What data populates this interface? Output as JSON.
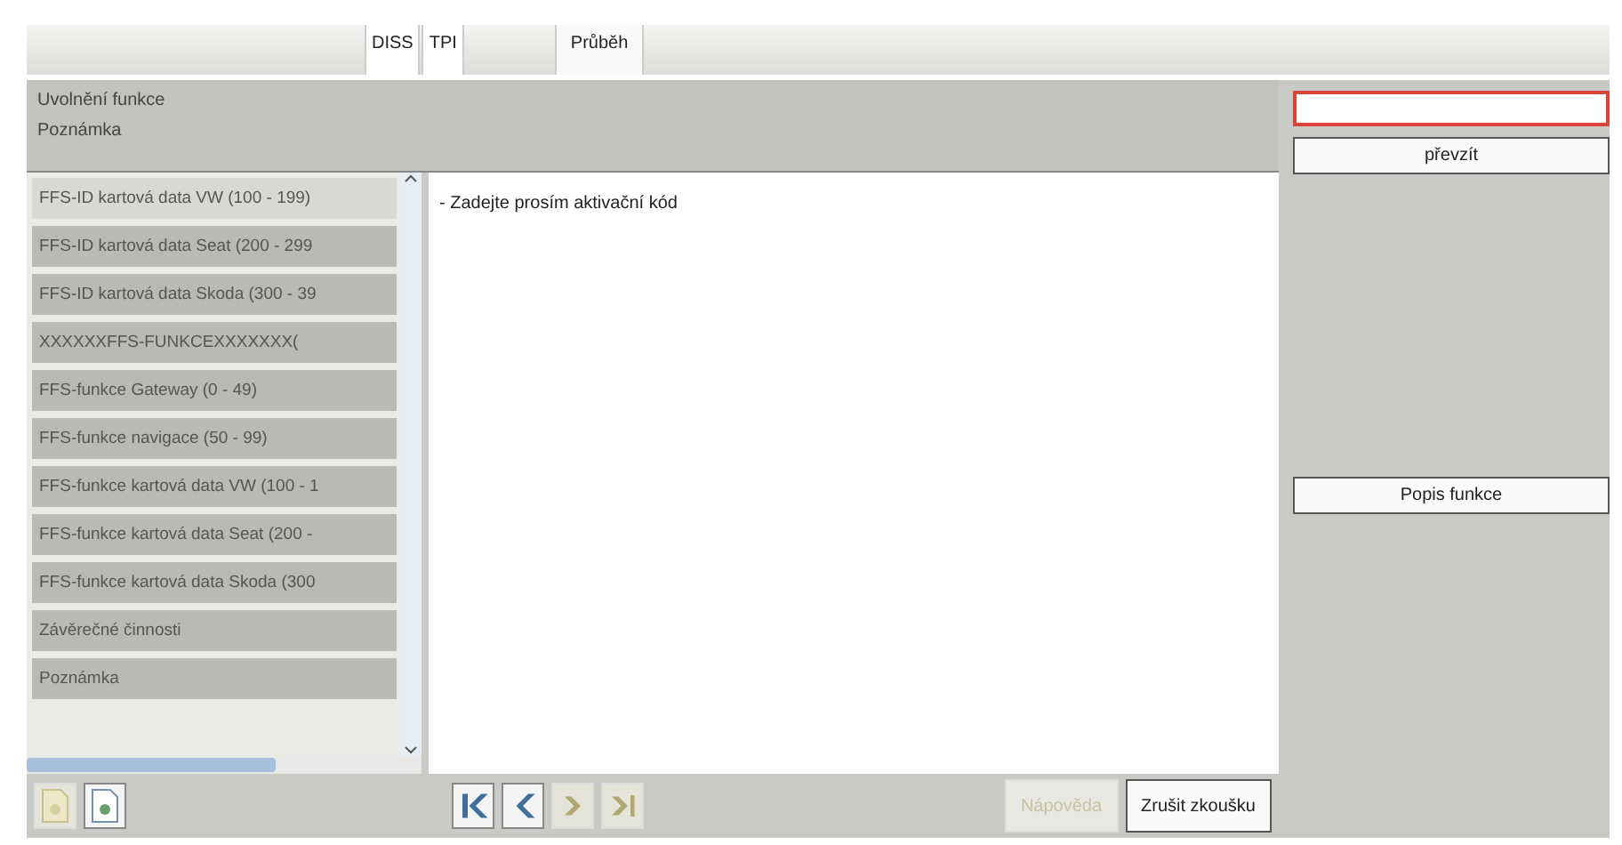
{
  "tabs": [
    {
      "label": "DISS",
      "selected": false
    },
    {
      "label": "TPI",
      "selected": false
    },
    {
      "label": "Průběh",
      "selected": true
    }
  ],
  "header": {
    "title": "Uvolnění funkce",
    "subtitle": "Poznámka"
  },
  "function_list": [
    {
      "label": "FFS-ID kartová data VW (100 - 199)",
      "selected": true
    },
    {
      "label": "FFS-ID kartová data Seat (200 - 299",
      "selected": false
    },
    {
      "label": "FFS-ID kartová data Skoda (300 - 39",
      "selected": false
    },
    {
      "label": "XXXXXXFFS-FUNKCEXXXXXXX(",
      "selected": false
    },
    {
      "label": "FFS-funkce Gateway (0 - 49)",
      "selected": false
    },
    {
      "label": "FFS-funkce navigace (50 - 99)",
      "selected": false
    },
    {
      "label": "FFS-funkce kartová data VW (100 - 1",
      "selected": false
    },
    {
      "label": "FFS-funkce kartová data Seat (200 -",
      "selected": false
    },
    {
      "label": "FFS-funkce kartová data Skoda (300",
      "selected": false
    },
    {
      "label": "Závěrečné činnosti",
      "selected": false
    },
    {
      "label": "Poznámka",
      "selected": false
    }
  ],
  "message": "- Zadejte prosím aktivační kód",
  "code_input": {
    "invalid": true
  },
  "take_over_button": "převzít",
  "describe_button": "Popis funkce",
  "doc_buttons": [
    {
      "disabled": true
    },
    {
      "disabled": false
    }
  ],
  "nav_buttons": [
    {
      "kind": "first",
      "disabled": false
    },
    {
      "kind": "prev",
      "disabled": false
    },
    {
      "kind": "next",
      "disabled": true
    },
    {
      "kind": "last",
      "disabled": true
    }
  ],
  "help_button": {
    "label": "Nápověda",
    "disabled": true
  },
  "cancel_button": {
    "label": "Zrušit zkoušku",
    "disabled": false
  }
}
